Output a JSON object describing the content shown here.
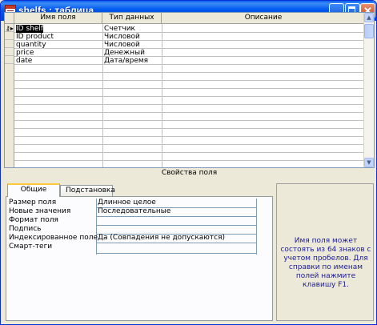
{
  "window": {
    "title": "shelfs : таблица"
  },
  "grid": {
    "headers": {
      "name": "Имя поля",
      "type": "Тип данных",
      "description": "Описание"
    },
    "rows": [
      {
        "name": "ID shelf",
        "type": "Счетчик"
      },
      {
        "name": "ID product",
        "type": "Числовой"
      },
      {
        "name": "quantity",
        "type": "Числовой"
      },
      {
        "name": "price",
        "type": "Денежный"
      },
      {
        "name": "date",
        "type": "Дата/время"
      }
    ]
  },
  "properties": {
    "title": "Свойства поля",
    "tabs": {
      "general": "Общие",
      "lookup": "Подстановка"
    },
    "labels": {
      "field_size": "Размер поля",
      "new_values": "Новые значения",
      "format": "Формат поля",
      "caption": "Подпись",
      "indexed": "Индексированное поле",
      "smart_tags": "Смарт-теги"
    },
    "values": {
      "field_size": "Длинное целое",
      "new_values": "Последовательные",
      "format": "",
      "caption": "",
      "indexed": "Да (Совпадения не допускаются)",
      "smart_tags": ""
    },
    "help": "Имя поля может состоять из 64 знаков с учетом пробелов. Для справки по именам полей нажмите клавишу F1."
  }
}
